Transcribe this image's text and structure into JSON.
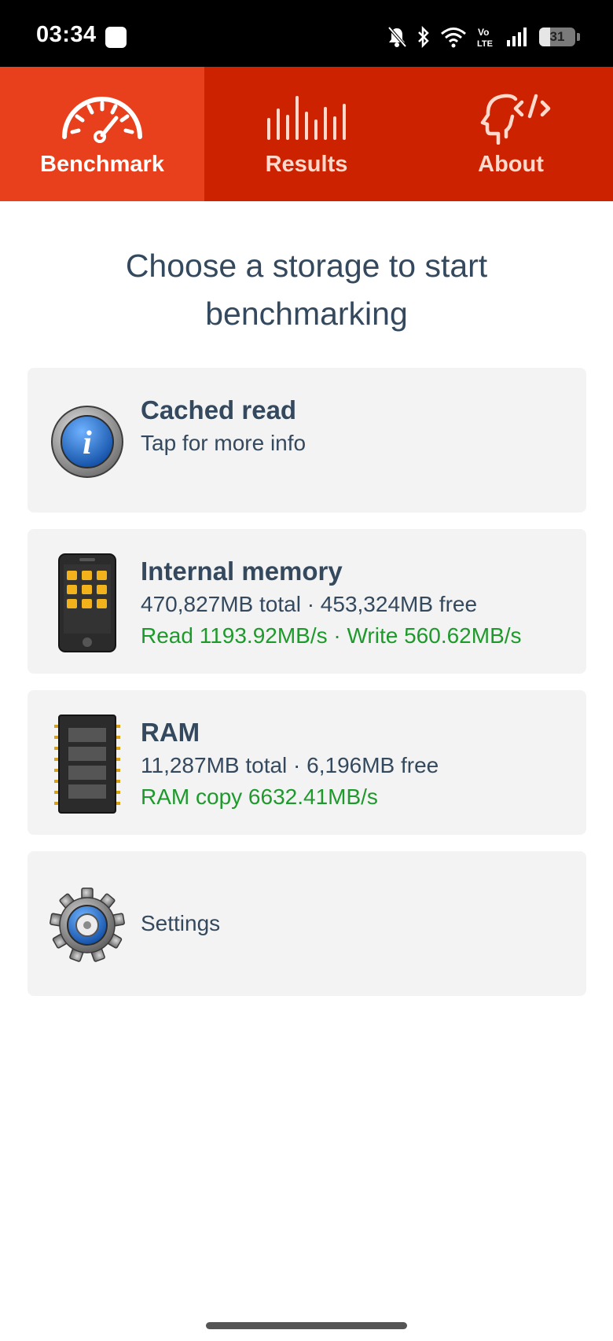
{
  "status_bar": {
    "time": "03:34",
    "battery_percent": 31,
    "battery_label": "31",
    "icons": [
      "notification-app-icon",
      "mute-icon",
      "bluetooth-icon",
      "wifi-icon",
      "volte-icon",
      "signal-icon",
      "battery-icon"
    ]
  },
  "tabs": [
    {
      "label": "Benchmark",
      "icon": "speedometer-icon",
      "active": true
    },
    {
      "label": "Results",
      "icon": "bars-icon",
      "active": false
    },
    {
      "label": "About",
      "icon": "head-code-icon",
      "active": false
    }
  ],
  "heading": {
    "line1": "Choose a storage to start",
    "line2": "benchmarking"
  },
  "cards": {
    "cached": {
      "title": "Cached read",
      "subtitle": "Tap for more info",
      "icon": "info-icon"
    },
    "internal": {
      "title": "Internal memory",
      "details": "470,827MB total · 453,324MB free",
      "speeds": "Read 1193.92MB/s · Write 560.62MB/s",
      "icon": "phone-icon"
    },
    "ram": {
      "title": "RAM",
      "details": "11,287MB total · 6,196MB free",
      "speeds": "RAM copy 6632.41MB/s",
      "icon": "ram-chip-icon"
    },
    "settings": {
      "label": "Settings",
      "icon": "gear-icon"
    }
  },
  "colors": {
    "tab_bar": "#cc2200",
    "tab_active": "#e8401c",
    "text": "#34495e",
    "speed_green": "#1e9a2c",
    "card_bg": "#f3f3f3"
  }
}
